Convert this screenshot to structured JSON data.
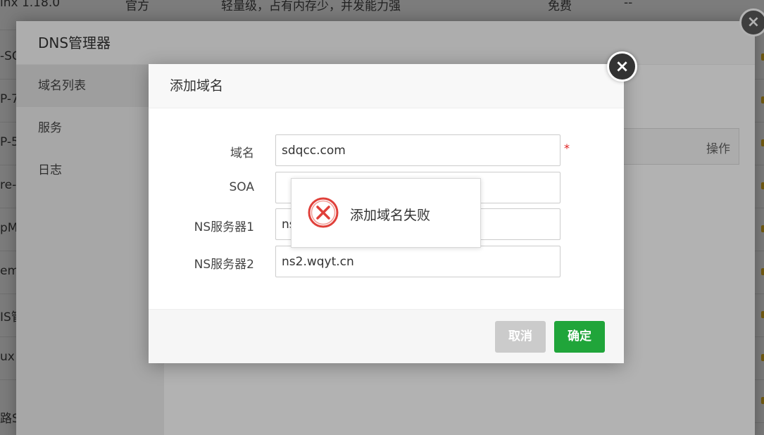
{
  "background_rows": [
    {
      "c1": "inx 1.18.0",
      "c2": "官方",
      "c3": "轻量级，占有内存少，并发能力强",
      "c4": "免费",
      "c5": "--"
    },
    {
      "c1": "-SC"
    },
    {
      "c1": "P-7"
    },
    {
      "c1": "P-5"
    },
    {
      "c1": "re-"
    },
    {
      "c1": "pM"
    },
    {
      "c1": "em"
    },
    {
      "c1": "IS管"
    },
    {
      "c1": "ux"
    },
    {
      "c1": "路S"
    }
  ],
  "dns_manager": {
    "title": "DNS管理器",
    "sidebar": [
      "域名列表",
      "服务",
      "日志"
    ],
    "table_header_op": "操作",
    "close_icon": "×"
  },
  "add_domain_dialog": {
    "title": "添加域名",
    "close_icon": "×",
    "fields": [
      {
        "label": "域名",
        "value": "sdqcc.com",
        "required": "*"
      },
      {
        "label": "SOA",
        "value": ""
      },
      {
        "label": "NS服务器1",
        "value": "ns"
      },
      {
        "label": "NS服务器2",
        "value": "ns2.wqyt.cn"
      }
    ],
    "cancel_label": "取消",
    "ok_label": "确定"
  },
  "toast": {
    "message": "添加域名失败",
    "icon": "error-icon"
  },
  "colors": {
    "accent_green": "#20a53a",
    "error_red": "#e0403a",
    "cancel_gray": "#cbcbcb"
  }
}
